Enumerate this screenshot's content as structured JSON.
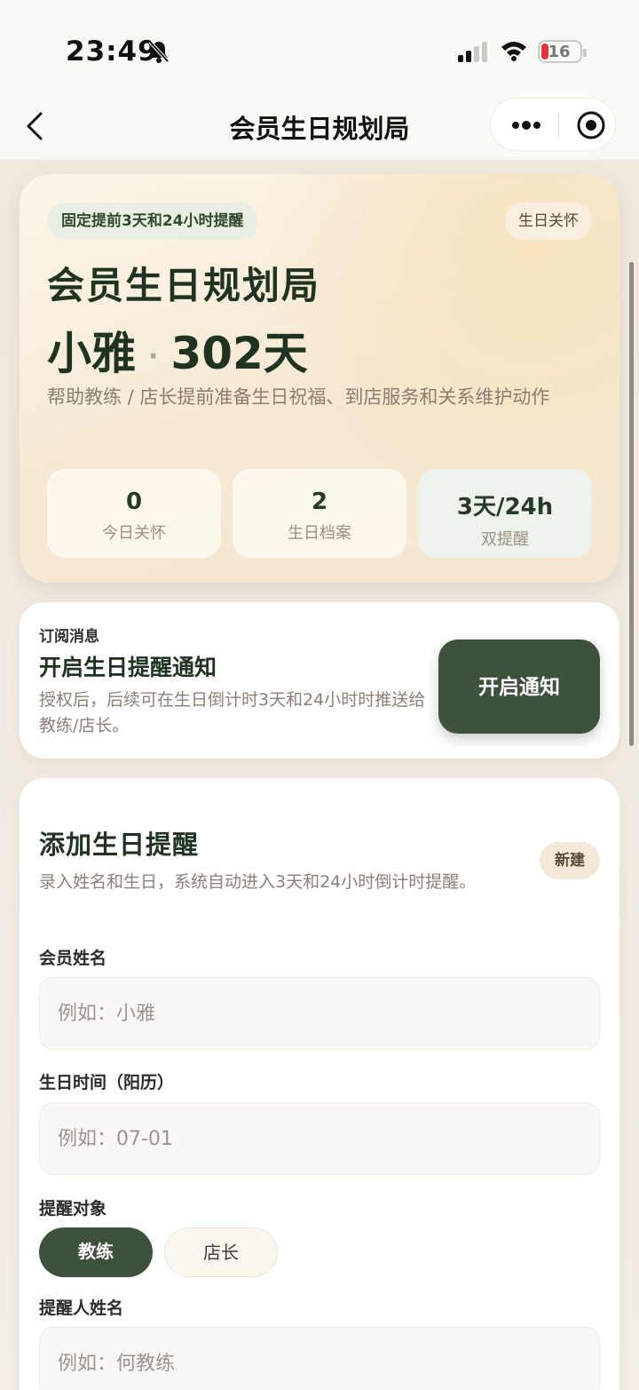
{
  "status_bar": {
    "time": "23:49",
    "battery": "16"
  },
  "nav": {
    "title": "会员生日规划局"
  },
  "hero": {
    "tag_left": "固定提前3天和24小时提醒",
    "tag_right": "生日关怀",
    "title": "会员生日规划局",
    "member_name": "小雅",
    "days": "302天",
    "separator": "·",
    "description": "帮助教练 / 店长提前准备生日祝福、到店服务和关系维护动作",
    "stats": [
      {
        "value": "0",
        "label": "今日关怀"
      },
      {
        "value": "2",
        "label": "生日档案"
      },
      {
        "value": "3天/24h",
        "label": "双提醒"
      }
    ]
  },
  "subscribe": {
    "kicker": "订阅消息",
    "title": "开启生日提醒通知",
    "description": "授权后，后续可在生日倒计时3天和24小时时推送给教练/店长。",
    "button": "开启通知"
  },
  "form": {
    "title": "添加生日提醒",
    "badge": "新建",
    "description": "录入姓名和生日，系统自动进入3天和24小时倒计时提醒。",
    "name_label": "会员姓名",
    "name_placeholder": "例如：小雅",
    "birthday_label": "生日时间（阳历）",
    "birthday_placeholder": "例如：07-01",
    "target_label": "提醒对象",
    "targets": [
      "教练",
      "店长"
    ],
    "selected_target": "教练",
    "reminder_name_label": "提醒人姓名",
    "reminder_name_placeholder": "例如：何教练"
  }
}
